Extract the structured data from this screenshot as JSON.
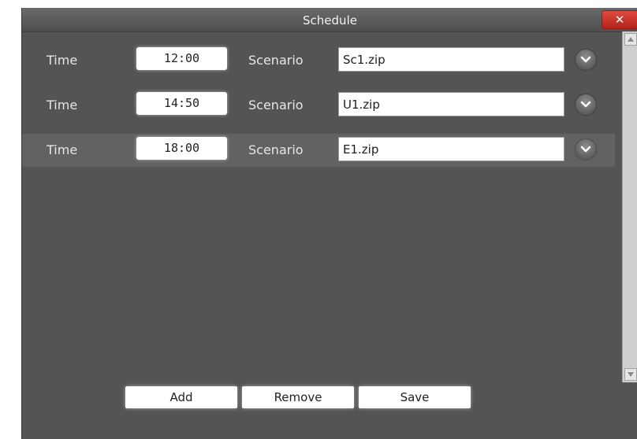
{
  "window": {
    "title": "Schedule",
    "close_label": "✕"
  },
  "rows": [
    {
      "time_label": "Time",
      "time": "12:00",
      "scenario_label": "Scenario",
      "scenario": "Sc1.zip",
      "selected": false
    },
    {
      "time_label": "Time",
      "time": "14:50",
      "scenario_label": "Scenario",
      "scenario": "U1.zip",
      "selected": false
    },
    {
      "time_label": "Time",
      "time": "18:00",
      "scenario_label": "Scenario",
      "scenario": "E1.zip",
      "selected": true
    }
  ],
  "buttons": {
    "add": "Add",
    "remove": "Remove",
    "save": "Save"
  },
  "icons": {
    "dropdown": "chevron-down-icon",
    "close": "close-icon",
    "scroll_up": "scroll-up-arrow-icon",
    "scroll_down": "scroll-down-arrow-icon"
  },
  "colors": {
    "background": "#545454",
    "selected_row": "#626262",
    "close_button": "#c8322a",
    "label_text": "#e6e6e6"
  }
}
